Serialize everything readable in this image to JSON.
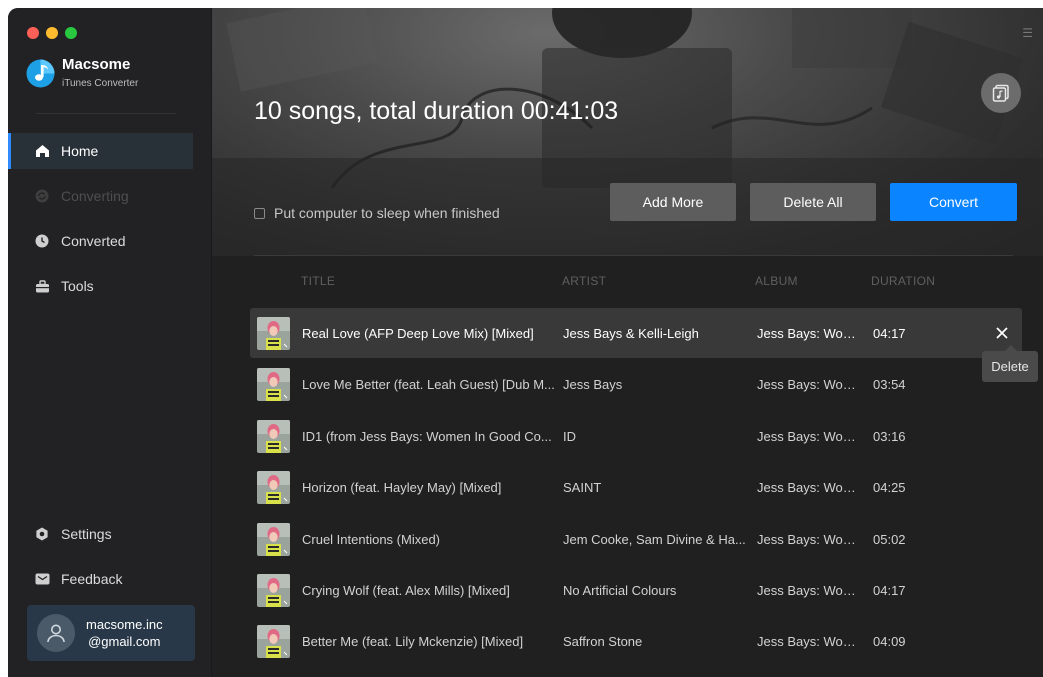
{
  "app": {
    "name": "Macsome",
    "subtitle": "iTunes Converter"
  },
  "sidebar": {
    "items": [
      {
        "label": "Home",
        "icon": "home-icon",
        "state": "active"
      },
      {
        "label": "Converting",
        "icon": "converting-icon",
        "state": "disabled"
      },
      {
        "label": "Converted",
        "icon": "clock-icon",
        "state": "normal"
      },
      {
        "label": "Tools",
        "icon": "toolbox-icon",
        "state": "normal"
      }
    ],
    "bottom_items": [
      {
        "label": "Settings",
        "icon": "gear-icon"
      },
      {
        "label": "Feedback",
        "icon": "mail-icon"
      }
    ],
    "account": {
      "line1": "macsome.inc",
      "line2": "@gmail.com"
    }
  },
  "header": {
    "summary": "10 songs, total duration 00:41:03",
    "sleep_label": "Put computer to sleep when finished",
    "sleep_checked": false,
    "buttons": {
      "add_more": "Add More",
      "delete_all": "Delete All",
      "convert": "Convert"
    }
  },
  "table": {
    "columns": [
      "TITLE",
      "ARTIST",
      "ALBUM",
      "DURATION"
    ],
    "rows": [
      {
        "title": "Real Love (AFP Deep Love Mix) [Mixed]",
        "artist": "Jess Bays & Kelli-Leigh",
        "album": "Jess Bays: Wom...",
        "duration": "04:17"
      },
      {
        "title": "Love Me Better (feat. Leah Guest) [Dub M...",
        "artist": "Jess Bays",
        "album": "Jess Bays: Wom...",
        "duration": "03:54"
      },
      {
        "title": "ID1 (from Jess Bays: Women In Good Co...",
        "artist": "ID",
        "album": "Jess Bays: Wom...",
        "duration": "03:16"
      },
      {
        "title": "Horizon (feat. Hayley May) [Mixed]",
        "artist": "SAINT",
        "album": "Jess Bays: Wom...",
        "duration": "04:25"
      },
      {
        "title": "Cruel Intentions (Mixed)",
        "artist": "Jem Cooke, Sam Divine & Ha...",
        "album": "Jess Bays: Wom...",
        "duration": "05:02"
      },
      {
        "title": "Crying Wolf (feat. Alex Mills) [Mixed]",
        "artist": "No Artificial Colours",
        "album": "Jess Bays: Wom...",
        "duration": "04:17"
      },
      {
        "title": "Better Me (feat. Lily Mckenzie) [Mixed]",
        "artist": "Saffron Stone",
        "album": "Jess Bays: Wom...",
        "duration": "04:09"
      }
    ],
    "selected_row": 0
  },
  "tooltip": "Delete",
  "colors": {
    "accent": "#0a84ff",
    "sidebar_bg": "#222224",
    "main_bg": "#202020",
    "selected_row": "#393939"
  }
}
